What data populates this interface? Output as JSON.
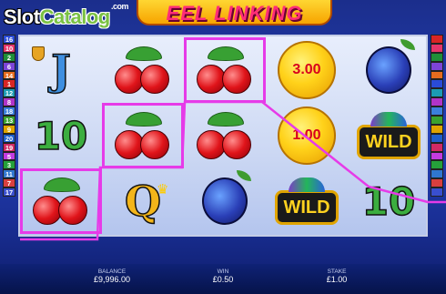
{
  "watermark": {
    "brand_a": "Slot",
    "brand_b": "Catalog",
    "suffix": ".com"
  },
  "game": {
    "title": "EEL LINKING"
  },
  "paylines": {
    "left": [
      {
        "n": "16",
        "color": "#2a4bd8"
      },
      {
        "n": "10",
        "color": "#e5356b"
      },
      {
        "n": "2",
        "color": "#1e8f38"
      },
      {
        "n": "6",
        "color": "#7d44d8"
      },
      {
        "n": "14",
        "color": "#e56c1f"
      },
      {
        "n": "1",
        "color": "#d92525"
      },
      {
        "n": "12",
        "color": "#1b9bb4"
      },
      {
        "n": "8",
        "color": "#b034c8"
      },
      {
        "n": "18",
        "color": "#3b7fdc"
      },
      {
        "n": "13",
        "color": "#3aa12f"
      },
      {
        "n": "9",
        "color": "#e0a400"
      },
      {
        "n": "20",
        "color": "#1f5fcc"
      },
      {
        "n": "19",
        "color": "#d12a65"
      },
      {
        "n": "5",
        "color": "#c33be0"
      },
      {
        "n": "3",
        "color": "#25a03a"
      },
      {
        "n": "11",
        "color": "#2f76cf"
      },
      {
        "n": "7",
        "color": "#d83f3f"
      },
      {
        "n": "17",
        "color": "#394fcf"
      }
    ],
    "right": [
      {
        "n": "",
        "color": "#d92525"
      },
      {
        "n": "",
        "color": "#e5356b"
      },
      {
        "n": "",
        "color": "#1e8f38"
      },
      {
        "n": "",
        "color": "#7d44d8"
      },
      {
        "n": "",
        "color": "#e56c1f"
      },
      {
        "n": "",
        "color": "#2a4bd8"
      },
      {
        "n": "",
        "color": "#1b9bb4"
      },
      {
        "n": "",
        "color": "#b034c8"
      },
      {
        "n": "",
        "color": "#3b7fdc"
      },
      {
        "n": "",
        "color": "#3aa12f"
      },
      {
        "n": "",
        "color": "#e0a400"
      },
      {
        "n": "",
        "color": "#1f5fcc"
      },
      {
        "n": "",
        "color": "#d12a65"
      },
      {
        "n": "",
        "color": "#c33be0"
      },
      {
        "n": "",
        "color": "#25a03a"
      },
      {
        "n": "",
        "color": "#2f76cf"
      },
      {
        "n": "",
        "color": "#d83f3f"
      },
      {
        "n": "",
        "color": "#394fcf"
      }
    ]
  },
  "reels": [
    [
      {
        "symbol": "J"
      },
      {
        "symbol": "10"
      },
      {
        "symbol": "cherries",
        "win": true
      }
    ],
    [
      {
        "symbol": "cherries"
      },
      {
        "symbol": "cherries",
        "win": true
      },
      {
        "symbol": "Q"
      }
    ],
    [
      {
        "symbol": "cherries",
        "win": true
      },
      {
        "symbol": "cherries"
      },
      {
        "symbol": "plum"
      }
    ],
    [
      {
        "symbol": "coin",
        "value": "3.00"
      },
      {
        "symbol": "coin",
        "value": "1.00"
      },
      {
        "symbol": "wild",
        "text": "WILD"
      }
    ],
    [
      {
        "symbol": "plum"
      },
      {
        "symbol": "wild",
        "text": "WILD"
      },
      {
        "symbol": "10"
      }
    ]
  ],
  "win_line_color": "#e63be8",
  "footer": {
    "balance_label": "BALANCE",
    "balance_value": "£9,996.00",
    "win_label": "WIN",
    "win_value": "£0.50",
    "stake_label": "STAKE",
    "stake_value": "£1.00"
  }
}
